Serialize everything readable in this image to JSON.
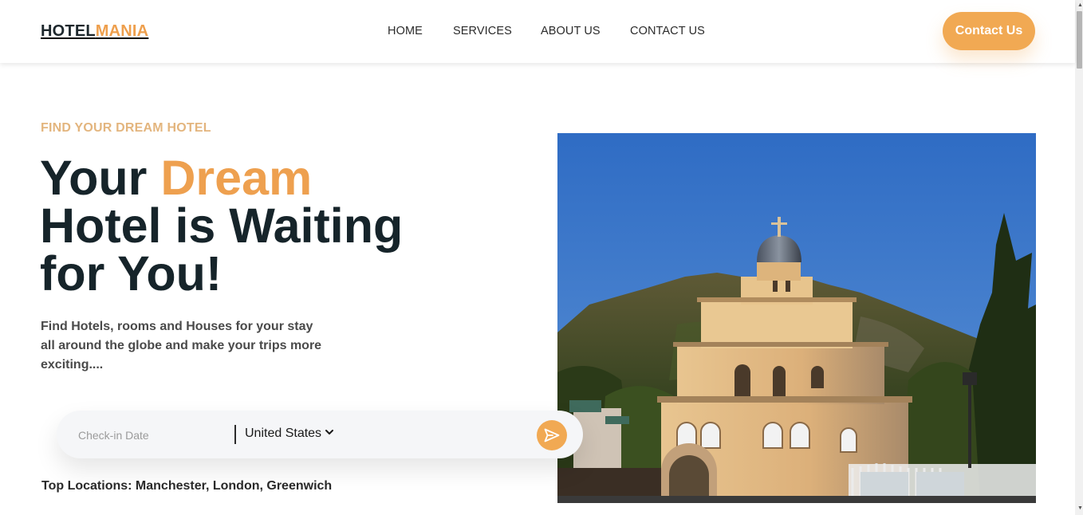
{
  "brand": {
    "part1": "HOTEL",
    "part2": "MANIA",
    "accent_color": "#ee9f4d"
  },
  "nav": {
    "items": [
      {
        "label": "HOME"
      },
      {
        "label": "SERVICES"
      },
      {
        "label": "ABOUT US"
      },
      {
        "label": "CONTACT US"
      }
    ]
  },
  "header": {
    "cta_label": "Contact Us",
    "cta_color": "#f1a953"
  },
  "hero": {
    "eyebrow": "FIND YOUR DREAM HOTEL",
    "headline_part1": "Your ",
    "headline_accent": "Dream",
    "headline_part2": "Hotel is Waiting for You!",
    "description": "Find Hotels, rooms and Houses for your stay all around the globe and make your trips more exciting....",
    "image_icon": "church-photo"
  },
  "search": {
    "checkin_placeholder": "Check-in Date",
    "checkin_value": "",
    "country_selected": "United States",
    "submit_icon": "send-icon"
  },
  "locations": {
    "text": "Top Locations: Manchester, London, Greenwich"
  },
  "colors": {
    "dark": "#16242a",
    "accent": "#eea04f",
    "eyebrow": "#e3b57e"
  }
}
